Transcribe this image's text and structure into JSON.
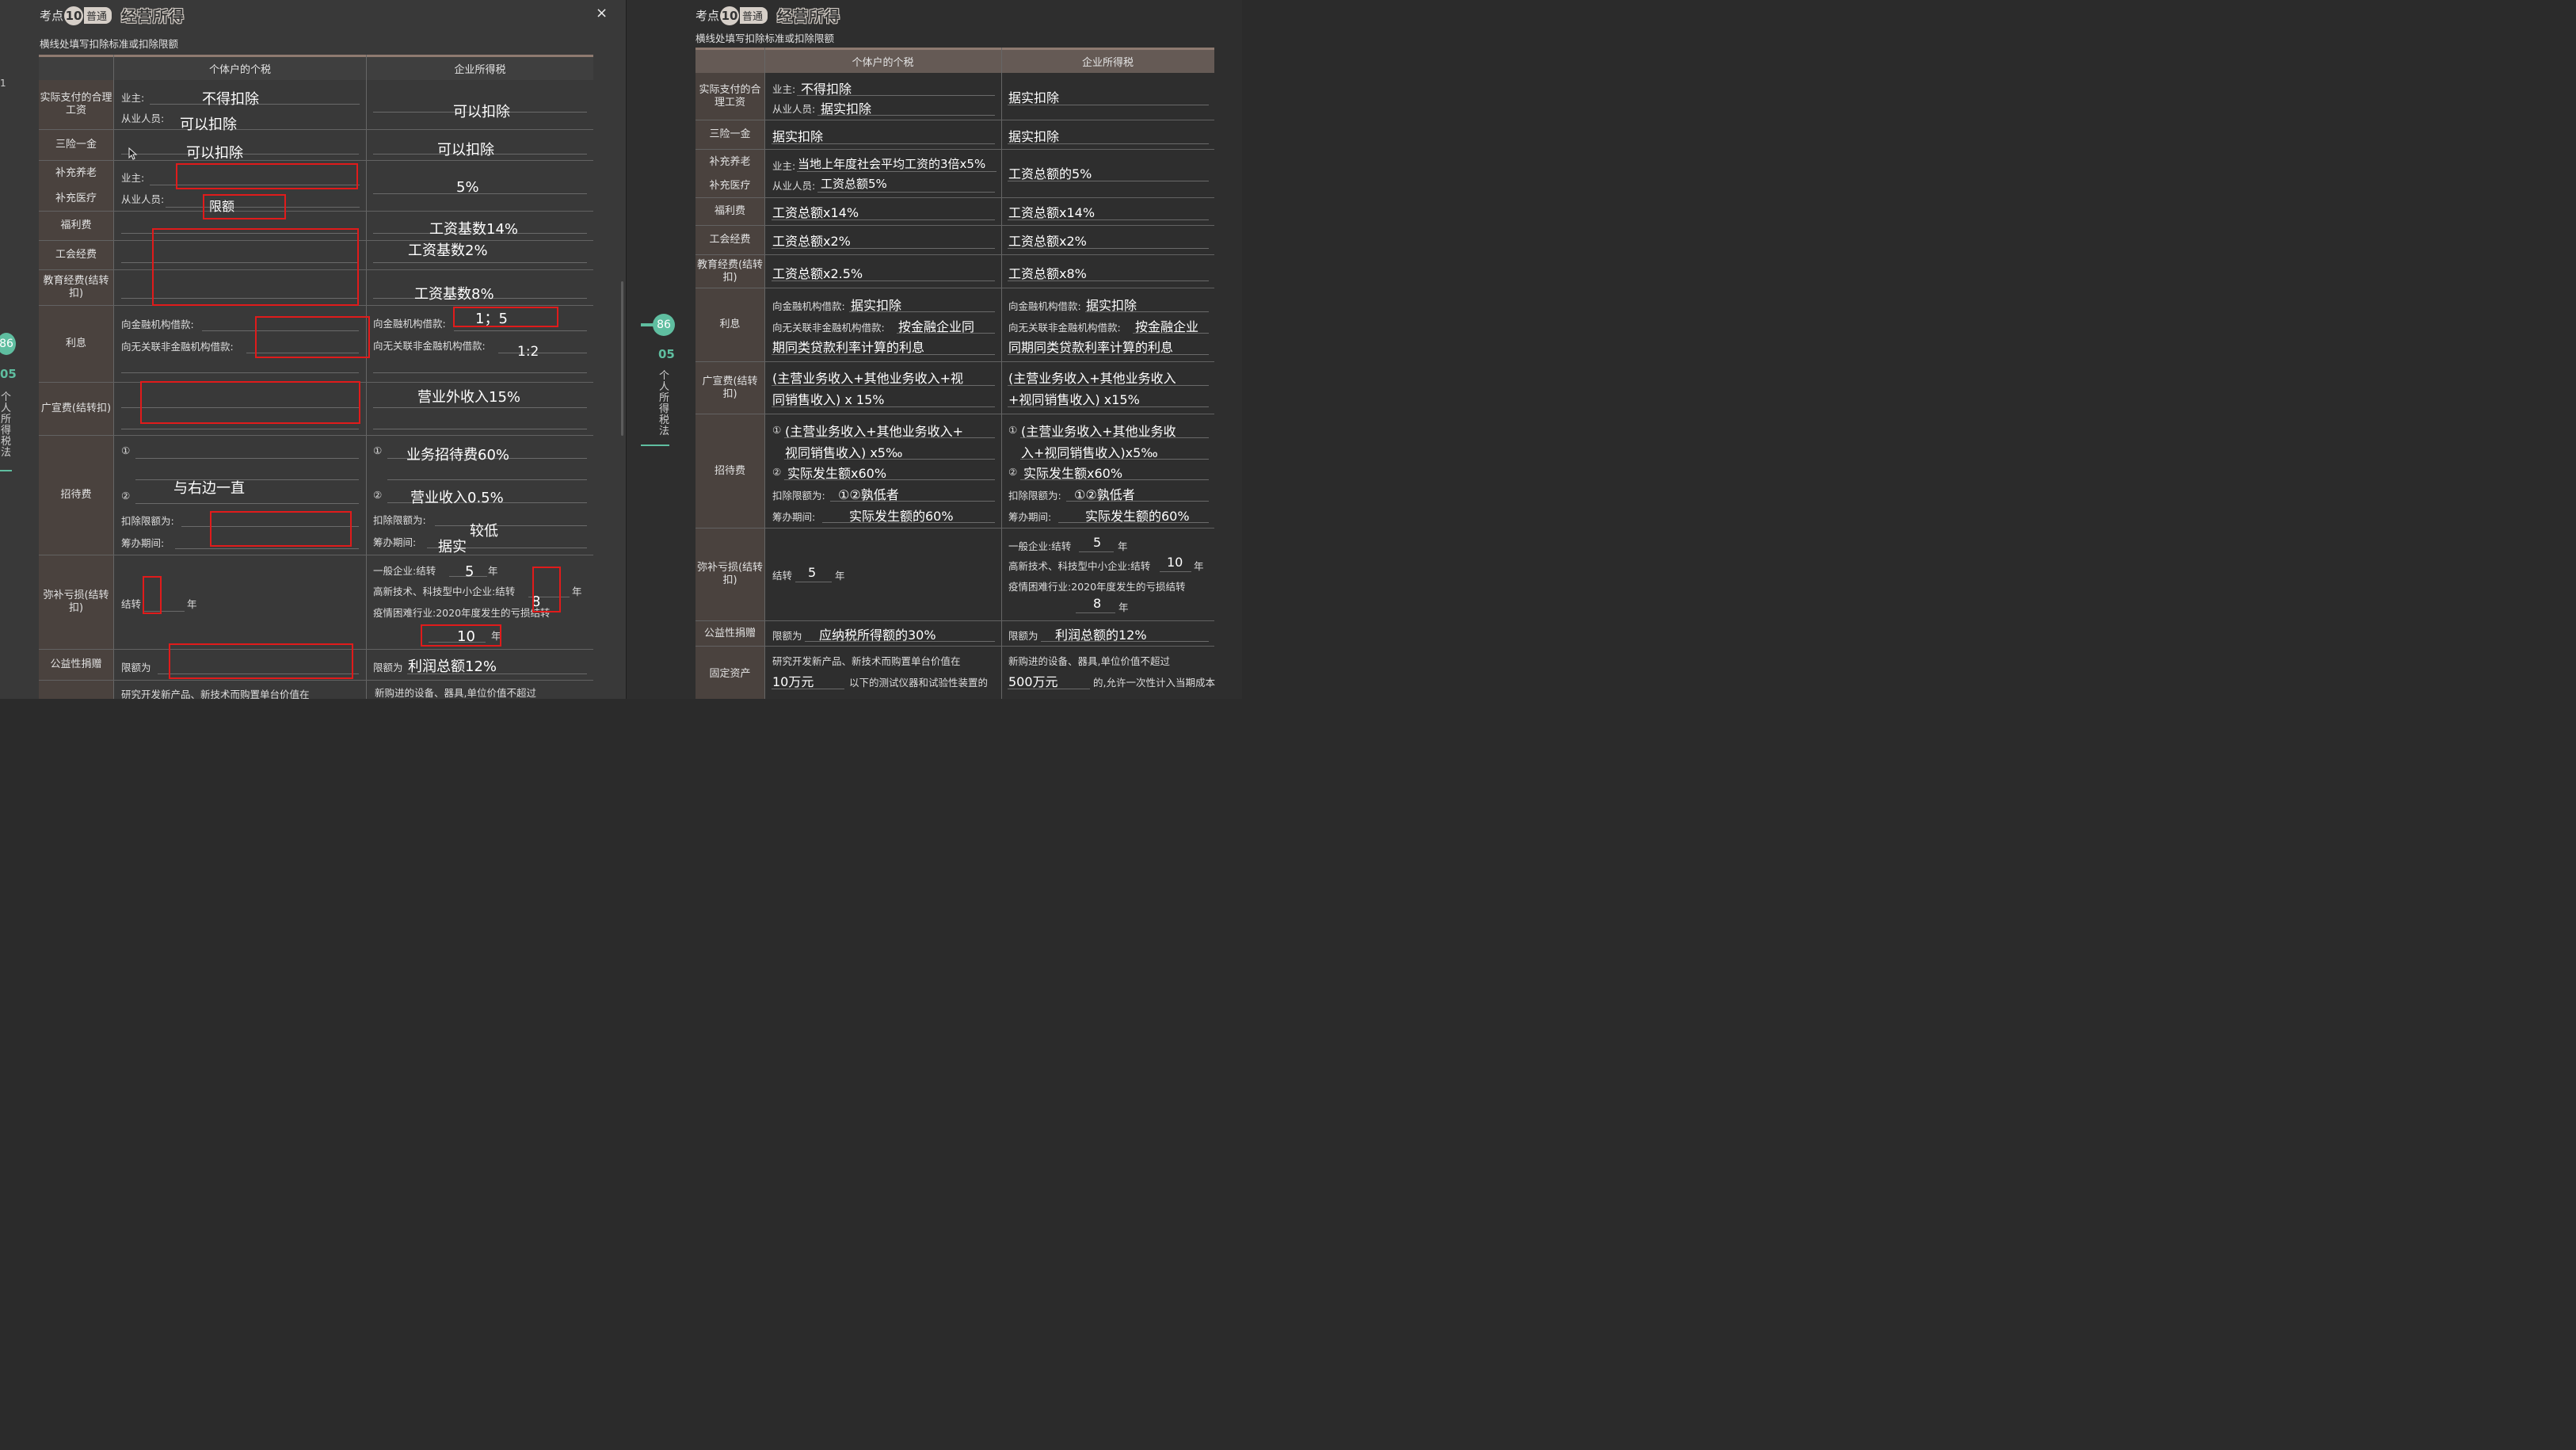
{
  "header": {
    "kaodian": "考点",
    "number": "10",
    "level": "普通",
    "title": "经营所得",
    "subtitle": "横线处填写扣除标准或扣除限额",
    "close_icon": "×"
  },
  "table_head": {
    "cat": "",
    "personal": "个体户的个税",
    "corp": "企业所得税"
  },
  "categories": {
    "wage": "实际支付的合理工资",
    "insurance": "三险一金",
    "pension": "补充养老",
    "medical": "补充医疗",
    "welfare": "福利费",
    "union": "工会经费",
    "education": "教育经费(结转扣)",
    "interest": "利息",
    "ad": "广宣费(结转扣)",
    "entertain": "招待费",
    "loss": "弥补亏损(结转扣)",
    "donation": "公益性捐赠",
    "asset": "固定资产"
  },
  "labels": {
    "owner": "业主:",
    "staff": "从业人员:",
    "fin_loan": "向金融机构借款:",
    "nonfin_loan": "向无关联非金融机构借款:",
    "circ1": "①",
    "circ2": "②",
    "deduct_limit": "扣除限额为:",
    "prep_period": "筹办期间:",
    "carry": "结转",
    "year": "年",
    "general_ent": "一般企业:结转",
    "hitech": "高新技术、科技型中小企业:结转",
    "covid": "疫情困难行业:2020年度发生的亏损结转",
    "limit_is": "限额为",
    "rd_text": "研究开发新产品、新技术而购置单台价值在",
    "equip_text": "新购进的设备、器具,单位价值不超过"
  },
  "left_notes": {
    "wage_owner": "不得扣除",
    "wage_staff": "可以扣除",
    "wage_corp": "可以扣除",
    "insurance_p": "可以扣除",
    "insurance_c": "可以扣除",
    "pension_c": "5%",
    "limit": "限额",
    "welfare_c": "工资基数14%",
    "union_c": "工资基数2%",
    "edu_c": "工资基数8%",
    "interest_ratio": "1；5",
    "interest_ratio2": "1:2",
    "ad_c": "营业外收入15%",
    "ent1_c": "业务招待费60%",
    "ent_left": "与右边一直",
    "ent2_c": "营业收入0.5%",
    "ent_limit_c": "较低",
    "ent_prep_c": "据实",
    "loss_general": "5",
    "loss_covid": "8",
    "loss_hitech": "10",
    "donation_c": "利润总额12%"
  },
  "right_notes": {
    "wage_owner": "不得扣除",
    "wage_staff": "据实扣除",
    "wage_corp": "据实扣除",
    "insurance_p": "据实扣除",
    "insurance_c": "据实扣除",
    "pension_owner": "当地上年度社会平均工资的3倍x5%",
    "pension_staff": "工资总额5%",
    "pension_c": "工资总额的5%",
    "welfare_p": "工资总额x14%",
    "welfare_c": "工资总额x14%",
    "union_p": "工资总额x2%",
    "union_c": "工资总额x2%",
    "edu_p": "工资总额x2.5%",
    "edu_c": "工资总额x8%",
    "fin_p": "据实扣除",
    "nonfin_p_1": "按金融企业同",
    "nonfin_p_2": "期同类贷款利率计算的利息",
    "fin_c": "据实扣除",
    "nonfin_c_1": "按金融企业",
    "nonfin_c_2": "同期同类贷款利率计算的利息",
    "ad_p_1": "(主营业务收入+其他业务收入+视",
    "ad_p_2": "同销售收入) x 15%",
    "ad_c_1": "(主营业务收入+其他业务收入",
    "ad_c_2": "+视同销售收入) x15%",
    "ent1_p_1": "(主营业务收入+其他业务收入+",
    "ent1_p_2": "视同销售收入) x5‰",
    "ent2_p": "实际发生额x60%",
    "ent_limit_p": "①②孰低者",
    "ent_prep_p": "实际发生额的60%",
    "ent1_c_1": "(主营业务收入+其他业务收",
    "ent1_c_2": "入+视同销售收入)x5‰",
    "ent2_c": "实际发生额x60%",
    "ent_limit_c": "①②孰低者",
    "ent_prep_c": "实际发生额的60%",
    "loss_p": "5",
    "loss_general": "5",
    "loss_hitech": "10",
    "loss_covid": "8",
    "donation_p": "应纳税所得额的30%",
    "donation_c": "利润总额的12%",
    "asset_p": "10万元",
    "asset_p_tail": "以下的测试仪器和试验性装置的",
    "asset_c": "500万元",
    "asset_c_tail": "的,允许一次性计入当期成本"
  },
  "side": {
    "page": "86",
    "chapter": "05",
    "chapter_name": "个人所得税法",
    "left_edge": "1"
  }
}
